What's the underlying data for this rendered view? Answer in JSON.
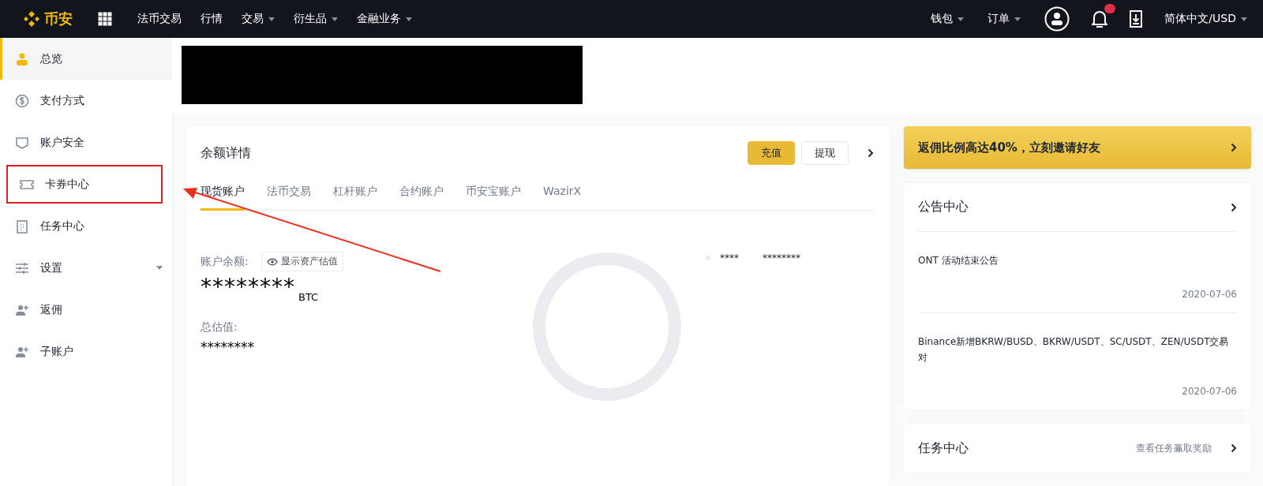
{
  "topbar": {
    "logo": "币安",
    "nav": [
      {
        "label": "法币交易",
        "dropdown": false
      },
      {
        "label": "行情",
        "dropdown": false
      },
      {
        "label": "交易",
        "dropdown": true
      },
      {
        "label": "衍生品",
        "dropdown": true
      },
      {
        "label": "金融业务",
        "dropdown": true
      }
    ],
    "right": [
      {
        "label": "钱包",
        "dropdown": true
      },
      {
        "label": "订单",
        "dropdown": true
      }
    ],
    "language": "简体中文/USD"
  },
  "sidebar": {
    "items": [
      {
        "label": "总览",
        "kind": "user",
        "selected": true,
        "highlighted": false,
        "dropdown": false
      },
      {
        "label": "支付方式",
        "kind": "dollar",
        "selected": false,
        "highlighted": false,
        "dropdown": false
      },
      {
        "label": "账户安全",
        "kind": "shield",
        "selected": false,
        "highlighted": false,
        "dropdown": false
      },
      {
        "label": "卡券中心",
        "kind": "ticket",
        "selected": false,
        "highlighted": true,
        "dropdown": false
      },
      {
        "label": "任务中心",
        "kind": "clipboard",
        "selected": false,
        "highlighted": false,
        "dropdown": false
      },
      {
        "label": "设置",
        "kind": "sliders",
        "selected": false,
        "highlighted": false,
        "dropdown": true
      },
      {
        "label": "返佣",
        "kind": "useradd",
        "selected": false,
        "highlighted": false,
        "dropdown": false
      },
      {
        "label": "子账户",
        "kind": "useradd",
        "selected": false,
        "highlighted": false,
        "dropdown": false
      }
    ]
  },
  "balance": {
    "title": "余额详情",
    "buttons": [
      {
        "label": "充值",
        "kind": "primary"
      },
      {
        "label": "提现",
        "kind": "secondary"
      }
    ],
    "tabs": [
      {
        "label": "现货账户",
        "selected": true
      },
      {
        "label": "法币交易",
        "selected": false
      },
      {
        "label": "杠杆账户",
        "selected": false
      },
      {
        "label": "合约账户",
        "selected": false
      },
      {
        "label": "币安宝账户",
        "selected": false
      },
      {
        "label": "WazirX",
        "selected": false
      }
    ],
    "account_label": "账户余额:",
    "show_value_button": "显示资产估值",
    "amount": "********",
    "unit": "BTC",
    "total_label": "总估值:",
    "total_value": "********",
    "legend": {
      "name": "****",
      "value": "********"
    }
  },
  "promo": {
    "text": "返佣比例高达40%，立刻邀请好友"
  },
  "announcements": {
    "title": "公告中心",
    "items": [
      {
        "text": "ONT 活动结束公告",
        "date": "2020-07-06"
      },
      {
        "text": "Binance新增BKRW/BUSD、BKRW/USDT、SC/USDT、ZEN/USDT交易对",
        "date": "2020-07-06"
      }
    ]
  },
  "tasks": {
    "title": "任务中心",
    "link": "查看任务赢取奖励"
  }
}
